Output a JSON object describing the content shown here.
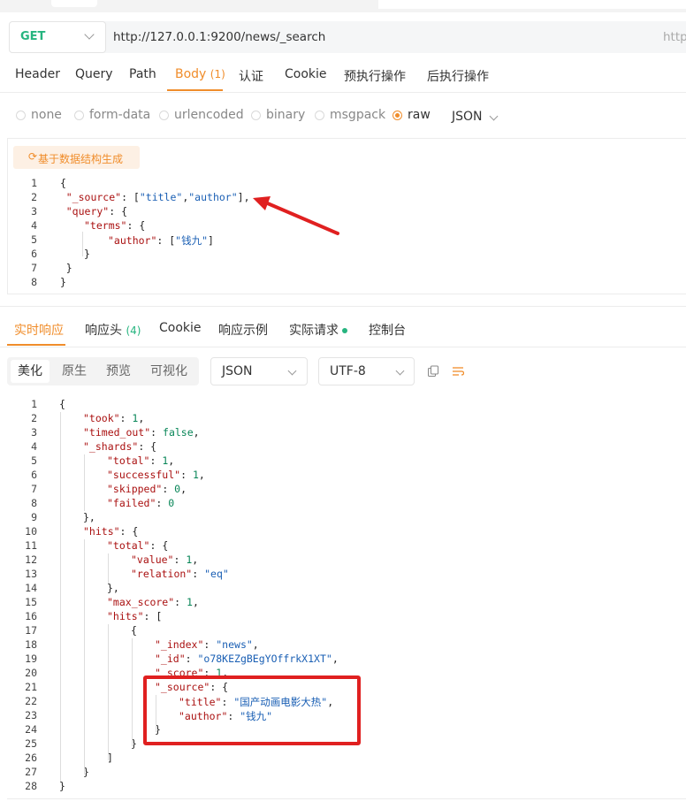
{
  "url_bar": {
    "method": "GET",
    "url": "http://127.0.0.1:9200/news/_search",
    "url_ghost": "http"
  },
  "request_tabs": [
    {
      "label": "Header"
    },
    {
      "label": "Query"
    },
    {
      "label": "Path"
    },
    {
      "label": "Body",
      "count": "(1)"
    },
    {
      "label": "认证"
    },
    {
      "label": "Cookie"
    },
    {
      "label": "预执行操作"
    },
    {
      "label": "后执行操作"
    }
  ],
  "body_types": {
    "options": [
      "none",
      "form-data",
      "urlencoded",
      "binary",
      "msgpack",
      "raw"
    ],
    "selected": "raw",
    "format": "JSON"
  },
  "generate_button": "基于数据结构生成",
  "request_body": [
    "{",
    "\"_source\": [\"title\",\"author\"],",
    "\"query\": {",
    "\"terms\": {",
    "\"author\": [\"钱九\"]",
    "}",
    "}",
    "}"
  ],
  "response_tabs": [
    {
      "label": "实时响应"
    },
    {
      "label": "响应头",
      "count": "(4)"
    },
    {
      "label": "Cookie"
    },
    {
      "label": "响应示例"
    },
    {
      "label": "实际请求"
    },
    {
      "label": "控制台"
    }
  ],
  "view_modes": [
    "美化",
    "原生",
    "预览",
    "可视化"
  ],
  "response_format": "JSON",
  "encoding": "UTF-8",
  "response_body": [
    "{",
    "\"took\": 1,",
    "\"timed_out\": false,",
    "\"_shards\": {",
    "\"total\": 1,",
    "\"successful\": 1,",
    "\"skipped\": 0,",
    "\"failed\": 0",
    "},",
    "\"hits\": {",
    "\"total\": {",
    "\"value\": 1,",
    "\"relation\": \"eq\"",
    "},",
    "\"max_score\": 1,",
    "\"hits\": [",
    "{",
    "\"_index\": \"news\",",
    "\"_id\": \"o78KEZgBEgYOffrkX1XT\",",
    "\"_score\": 1,",
    "\"_source\": {",
    "\"title\": \"国产动画电影大热\",",
    "\"author\": \"钱九\"",
    "}",
    "}",
    "]",
    "}",
    "}"
  ],
  "colors": {
    "accent": "#f08d2b",
    "method_green": "#26b47f",
    "annotation_red": "#e02020"
  }
}
